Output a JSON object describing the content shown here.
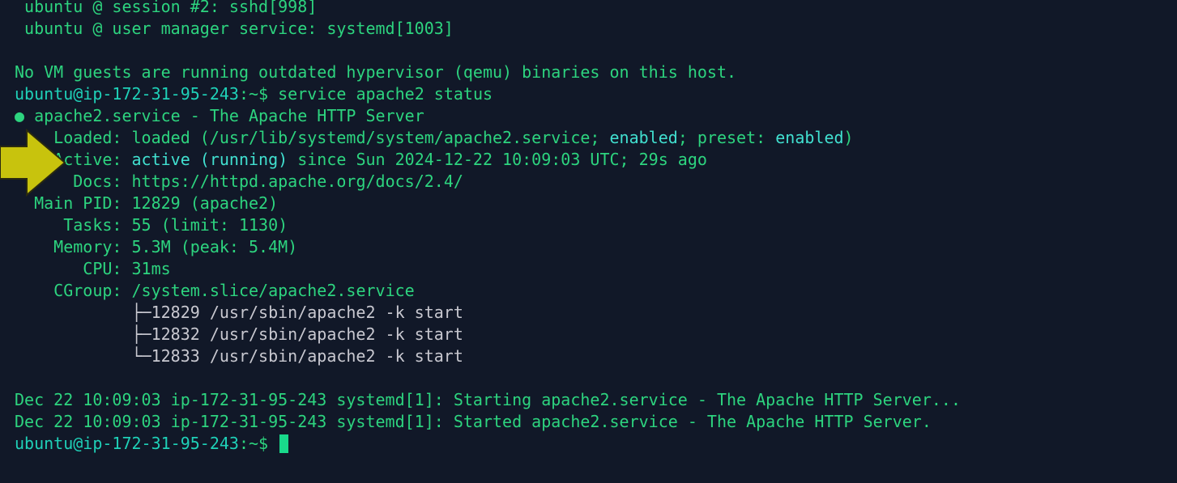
{
  "terminal": {
    "lines": {
      "l1": " ubuntu @ session #2: sshd[998]",
      "l2": " ubuntu @ user manager service: systemd[1003]",
      "l4": "No VM guests are running outdated hypervisor (qemu) binaries on this host.",
      "prompt1_user": "ubuntu@ip-172-31-95-243",
      "prompt1_path": ":~$ ",
      "prompt1_cmd": "service apache2 status",
      "svc_bullet": "●",
      "svc_name": " apache2.service - The Apache HTTP Server",
      "loaded_key": "    Loaded: ",
      "loaded_a": "loaded (/usr/lib/systemd/system/apache2.service; ",
      "loaded_enabled1": "enabled",
      "loaded_b": "; preset: ",
      "loaded_enabled2": "enabled",
      "loaded_c": ")",
      "active_key": "    Active: ",
      "active_state": "active (running)",
      "active_rest": " since Sun 2024-12-22 10:09:03 UTC; 29s ago",
      "docs_key": "      Docs: ",
      "docs_url": "https://httpd.apache.org/docs/2.4/",
      "pid_key": "  Main PID: ",
      "pid_val": "12829 (apache2)",
      "tasks_key": "     Tasks: ",
      "tasks_val": "55 (limit: 1130)",
      "mem_key": "    Memory: ",
      "mem_val": "5.3M (peak: 5.4M)",
      "cpu_key": "       CPU: ",
      "cpu_val": "31ms",
      "cgroup_key": "    CGroup: ",
      "cgroup_val": "/system.slice/apache2.service",
      "proc1": "            ├─12829 /usr/sbin/apache2 -k start",
      "proc2": "            ├─12832 /usr/sbin/apache2 -k start",
      "proc3": "            └─12833 /usr/sbin/apache2 -k start",
      "log1": "Dec 22 10:09:03 ip-172-31-95-243 systemd[1]: Starting apache2.service - The Apache HTTP Server...",
      "log2": "Dec 22 10:09:03 ip-172-31-95-243 systemd[1]: Started apache2.service - The Apache HTTP Server.",
      "prompt2_user": "ubuntu@ip-172-31-95-243",
      "prompt2_path": ":~$ "
    },
    "colors": {
      "background": "#111828",
      "text_green": "#2dd47f",
      "highlight_cyan": "#41e0d0",
      "arrow_fill": "#c8c30d",
      "cursor": "#19d98b"
    },
    "annotation_icon": "yellow-arrow-icon"
  }
}
